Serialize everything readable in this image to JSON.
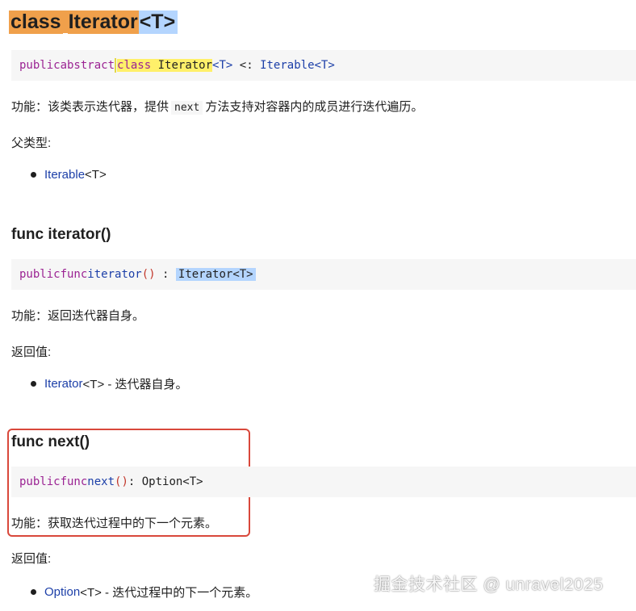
{
  "title": {
    "class_kw": "class",
    "name": "Iterator",
    "generic": "<T>"
  },
  "class_signature": {
    "public": "public",
    "abstract": "abstract",
    "class": "class",
    "name": "Iterator",
    "generic1": "<T>",
    "subtype_op": " <: ",
    "parent": "Iterable",
    "generic2": "<T>"
  },
  "class_desc": {
    "before": "功能：该类表示迭代器，提供",
    "code": "next",
    "after": "方法支持对容器内的成员进行迭代遍历。"
  },
  "parent_label": "父类型:",
  "parent_item": {
    "link": "Iterable",
    "suffix": "<T>"
  },
  "iterator_func": {
    "heading": "func iterator()",
    "sig": {
      "public": "public",
      "func": "func",
      "name": "iterator",
      "parens": "()",
      "colon": " : ",
      "ret": "Iterator<T>"
    },
    "desc": "功能：返回迭代器自身。",
    "return_label": "返回值:",
    "return_item": {
      "link": "Iterator",
      "suffix": "<T> - 迭代器自身。"
    }
  },
  "next_func": {
    "heading": "func next()",
    "sig": {
      "public": "public",
      "func": "func",
      "name": "next",
      "parens": "()",
      "ret": ": Option<T>"
    },
    "desc": "功能：获取迭代过程中的下一个元素。",
    "return_label": "返回值:",
    "return_item": {
      "link": "Option",
      "suffix": "<T> - 迭代过程中的下一个元素。"
    }
  },
  "watermark": "掘金技术社区 @ unravel2025",
  "colors": {
    "highlight_orange": "#f0a04b",
    "highlight_blue": "#b4d5fe",
    "highlight_yellow": "#fff06a",
    "keyword": "#9b2393",
    "type": "#1c3fa8",
    "red_box": "#d9483b"
  }
}
